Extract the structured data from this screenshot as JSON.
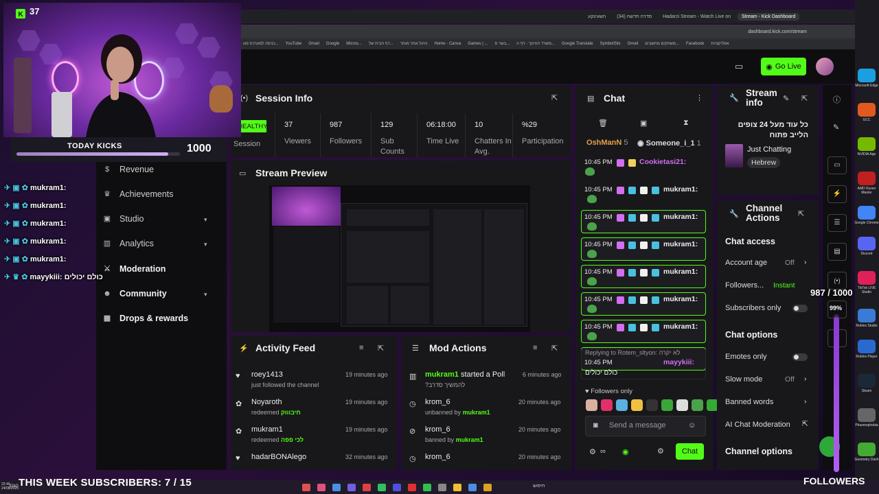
{
  "browser": {
    "tabs": [
      "Stream - Kick Dashboard",
      "Hadarzi Stream - Watch Live on",
      "סדרה חדשה (34)",
      "השעינקע"
    ],
    "url": "dashboard.kick.com/stream",
    "bookmarks": [
      "כניסה למערכת פוג...",
      "YouTube",
      "Gmail",
      "Google",
      "Micros...",
      "דף הבית של...",
      "ניהול אתר מותר",
      "Home - Canva",
      "Games | ...",
      "בשר ס...",
      "משרד החינוך - דף ה...",
      "Google Translate",
      "SymbolStix",
      "Gmail",
      "משחקים מחשבים...",
      "Facebook",
      "אפליקציות"
    ]
  },
  "overlay": {
    "kicks_count": "37",
    "today_kicks_label": "TODAY KICKS",
    "today_kicks_value": "1000",
    "today_kicks_progress": 0.93,
    "chat_lines": [
      {
        "user": "mukram1:",
        "text": ""
      },
      {
        "user": "mukram1:",
        "text": ""
      },
      {
        "user": "mukram1:",
        "text": ""
      },
      {
        "user": "mukram1:",
        "text": ""
      },
      {
        "user": "mukram1:",
        "text": ""
      },
      {
        "user": "mayykiii:",
        "text": "כולם יכולים"
      }
    ],
    "subscribers_banner": "THIS WEEK SUBSCRIBERS: 7 / 15",
    "followers_label": "FOLLOWERS",
    "followers_goal": "987 / 1000",
    "followers_percent": "99%"
  },
  "sidebar": {
    "items": [
      {
        "label": "Revenue",
        "icon": "dollar-icon",
        "chevron": false
      },
      {
        "label": "Achievements",
        "icon": "trophy-icon",
        "chevron": false
      },
      {
        "label": "Studio",
        "icon": "studio-icon",
        "chevron": true
      },
      {
        "label": "Analytics",
        "icon": "chart-icon",
        "chevron": true
      },
      {
        "label": "Moderation",
        "icon": "sword-icon",
        "chevron": false
      },
      {
        "label": "Community",
        "icon": "people-icon",
        "chevron": true
      },
      {
        "label": "Drops & rewards",
        "icon": "gift-icon",
        "chevron": false
      }
    ]
  },
  "header": {
    "go_live": "Go Live"
  },
  "session": {
    "title": "Session Info",
    "status": "HEALTHY",
    "status_label": "Session",
    "stats": [
      {
        "value": "37",
        "label": "Viewers"
      },
      {
        "value": "987",
        "label": "Followers"
      },
      {
        "value": "129",
        "label": "Sub Counts"
      },
      {
        "value": "06:18:00",
        "label": "Time Live"
      },
      {
        "value": "10",
        "label": "Chatters In Avg."
      },
      {
        "value": "%29",
        "label": "Participation"
      }
    ]
  },
  "preview": {
    "title": "Stream Preview"
  },
  "activity": {
    "title": "Activity Feed",
    "items": [
      {
        "name": "roey1413",
        "sub": "just followed the channel",
        "highlight": "",
        "time": "19 minutes ago"
      },
      {
        "name": "Noyaroth",
        "sub": "redeemed",
        "highlight": "חיבוווק",
        "time": "19 minutes ago"
      },
      {
        "name": "mukram1",
        "sub": "redeemed",
        "highlight": "לכי פפה",
        "time": "19 minutes ago"
      },
      {
        "name": "hadarBONAlego",
        "sub": "",
        "highlight": "",
        "time": "32 minutes ago"
      }
    ]
  },
  "mod_actions": {
    "title": "Mod Actions",
    "items": [
      {
        "name": "mukram1",
        "action": "started a Poll",
        "sub": "?להמשיך סדרב",
        "by": "",
        "time": "6 minutes ago"
      },
      {
        "name": "krom_6",
        "action": "",
        "sub": "unbanned by",
        "by": "mukram1",
        "time": "20 minutes ago"
      },
      {
        "name": "krom_6",
        "action": "",
        "sub": "banned by",
        "by": "mukram1",
        "time": "20 minutes ago"
      },
      {
        "name": "krom_6",
        "action": "",
        "sub": "",
        "by": "",
        "time": "20 minutes ago"
      }
    ]
  },
  "chat": {
    "title": "Chat",
    "tabs": [
      {
        "name": "OshManN",
        "count": "5"
      },
      {
        "name": "Someone_i_1",
        "count": "1"
      }
    ],
    "messages": [
      {
        "time": "10:45 PM",
        "user": "Cookietasi21:",
        "color": "#d36ef0",
        "boxed": false
      },
      {
        "time": "10:45 PM",
        "user": "mukram1:",
        "color": "#eeeeee",
        "boxed": true
      },
      {
        "time": "10:45 PM",
        "user": "mukram1:",
        "color": "#eeeeee",
        "boxed": true
      },
      {
        "time": "10:45 PM",
        "user": "mukram1:",
        "color": "#eeeeee",
        "boxed": true
      },
      {
        "time": "10:45 PM",
        "user": "mukram1:",
        "color": "#eeeeee",
        "boxed": true
      },
      {
        "time": "10:45 PM",
        "user": "mukram1:",
        "color": "#eeeeee",
        "boxed": true
      },
      {
        "time": "10:45 PM",
        "user": "mukram1:",
        "color": "#eeeeee",
        "boxed": true
      }
    ],
    "reply": {
      "replying_to": "Replying to Rotem_sltyon: לא יקרה",
      "time": "10:45 PM",
      "user": "mayykiii:",
      "text": "כולם יכולים"
    },
    "followers_only": "Followers only",
    "placeholder": "Send a message",
    "send_label": "Chat"
  },
  "stream_info": {
    "title": "Stream info",
    "stream_title": "כל עוד מעל 24 צופים הלייב פתוח",
    "category": "Just Chatting",
    "tag": "Hebrew"
  },
  "channel_actions": {
    "title": "Channel Actions",
    "chat_access": "Chat access",
    "account_age": {
      "label": "Account age",
      "value": "Off"
    },
    "followers": {
      "label": "Followers...",
      "value": "Instant"
    },
    "subscribers_only": "Subscribers only",
    "chat_options": "Chat options",
    "emotes_only": "Emotes only",
    "slow_mode": {
      "label": "Slow mode",
      "value": "Off"
    },
    "banned_words": "Banned words",
    "ai_moderation": "AI Chat Moderation",
    "channel_options": "Channel options"
  },
  "desktop_icons": [
    {
      "label": "Microsoft Edge",
      "color": "#1aa0e0"
    },
    {
      "label": "GCC",
      "color": "#e05a20"
    },
    {
      "label": "NVIDIA App",
      "color": "#76b900"
    },
    {
      "label": "AMD Ryzen Master",
      "color": "#c02020"
    },
    {
      "label": "Google Chrome",
      "color": "#4285f4"
    },
    {
      "label": "Discord",
      "color": "#5865f2"
    },
    {
      "label": "TikTok LIVE Studio",
      "color": "#e0205a"
    },
    {
      "label": "Roblox Studio",
      "color": "#3a7bd5"
    },
    {
      "label": "Roblox Player",
      "color": "#2a6ad0"
    },
    {
      "label": "Steam",
      "color": "#1b2838"
    },
    {
      "label": "Phasmophobia",
      "color": "#666666"
    },
    {
      "label": "Geometry Dash",
      "color": "#44aa33"
    }
  ],
  "taskbar": {
    "time": "22:45",
    "date": "24/08/2025",
    "lang": "ENG",
    "search": "חיפוש"
  },
  "colors": {
    "accent": "#53fc18",
    "panel": "#18181b",
    "bg": "#0e0e10"
  }
}
